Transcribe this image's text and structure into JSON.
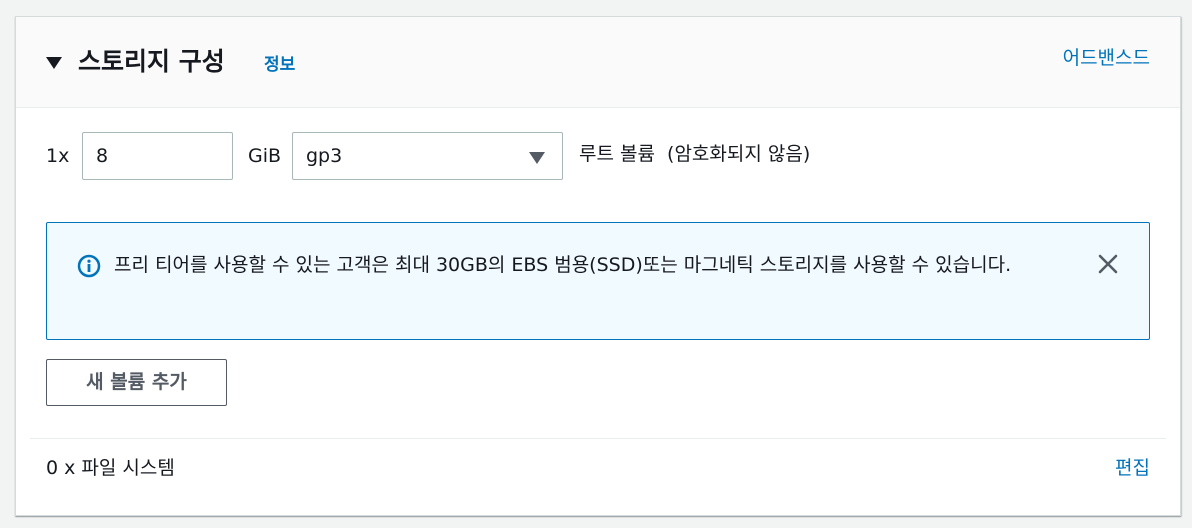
{
  "section": {
    "title": "스토리지 구성",
    "info_link": "정보",
    "advanced_link": "어드밴스드"
  },
  "volume": {
    "count_label": "1x",
    "size_value": "8",
    "size_unit": "GiB",
    "type_value": "gp3",
    "description": "루트 볼륨  (암호화되지 않음)"
  },
  "alert": {
    "type": "info",
    "icon": "info-circle-icon",
    "message": "프리 티어를 사용할 수 있는 고객은 최대 30GB의 EBS 범용(SSD)또는 마그네틱 스토리지를 사용할 수 있습니다.",
    "close_icon": "close-icon"
  },
  "add_volume_button": "새 볼륨 추가",
  "file_systems": {
    "label": "0 x 파일 시스템",
    "edit_link": "편집"
  },
  "colors": {
    "link": "#0073bb",
    "alert_bg": "#f1faff",
    "alert_border": "#0073bb",
    "text": "#16191f",
    "secondary_text": "#545b64",
    "header_bg": "#fafafa"
  }
}
